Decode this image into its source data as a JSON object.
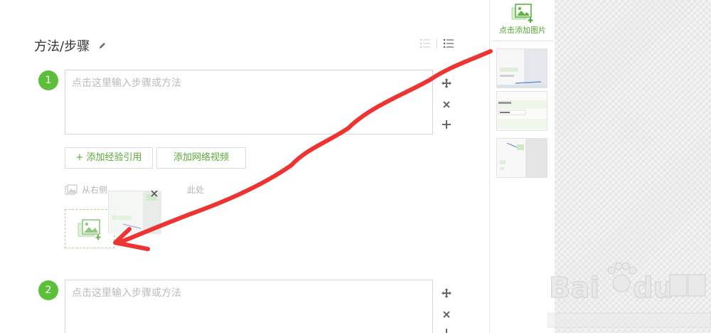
{
  "section": {
    "title": "方法/步骤"
  },
  "steps": [
    {
      "number": "1",
      "placeholder": "点击这里输入步骤或方法"
    },
    {
      "number": "2",
      "placeholder": "点击这里输入步骤或方法"
    }
  ],
  "actions": {
    "add_reference": "添加经验引用",
    "add_video": "添加网络视频",
    "plus": "+"
  },
  "drag_hint": "从右侧",
  "drag_hint_tail": "此处",
  "side_panel": {
    "add_image_label": "点击添加图片"
  },
  "colors": {
    "accent_green": "#5bbf3a",
    "link_green": "#5aa637",
    "arrow_red": "#ee3333"
  },
  "icons": [
    "edit-icon",
    "numbered-list-icon",
    "bullet-list-icon",
    "move-icon",
    "close-icon",
    "plus-icon",
    "image-icon",
    "add-image-icon"
  ]
}
